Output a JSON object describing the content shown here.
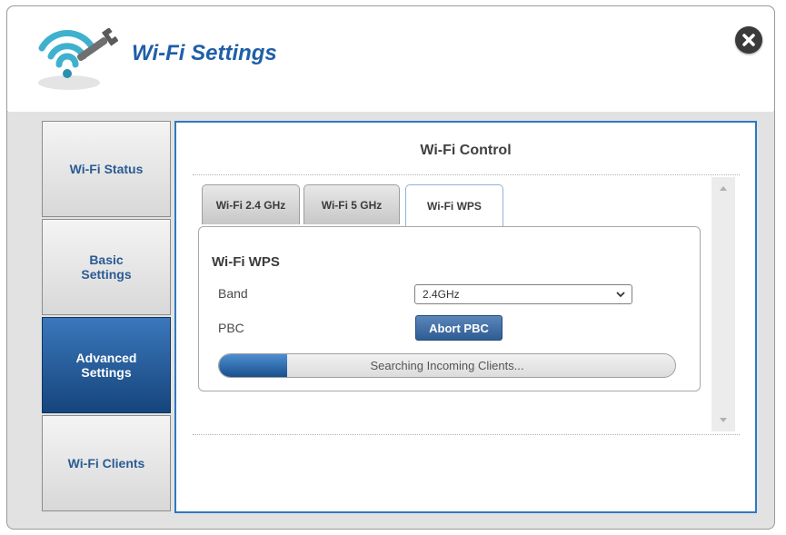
{
  "window": {
    "title": "Wi-Fi Settings",
    "logo_icon": "wifi-settings-icon",
    "close_icon": "close-icon"
  },
  "sidebar": {
    "items": [
      {
        "label": "Wi-Fi Status",
        "active": false
      },
      {
        "label": "Basic Settings",
        "active": false
      },
      {
        "label": "Advanced Settings",
        "active": true
      },
      {
        "label": "Wi-Fi Clients",
        "active": false
      }
    ]
  },
  "panel": {
    "title": "Wi-Fi Control",
    "tabs": [
      {
        "label": "Wi-Fi 2.4 GHz",
        "active": false
      },
      {
        "label": "Wi-Fi 5 GHz",
        "active": false
      },
      {
        "label": "Wi-Fi WPS",
        "active": true
      }
    ],
    "section": {
      "heading": "Wi-Fi WPS",
      "band_label": "Band",
      "band_value": "2.4GHz",
      "pbc_label": "PBC",
      "abort_button": "Abort PBC",
      "progress_text": "Searching Incoming Clients...",
      "progress_fraction": 0.15
    }
  },
  "colors": {
    "accent": "#1f5fa8",
    "active_nav": "#1e4f88",
    "panel_border": "#2f78c0"
  }
}
